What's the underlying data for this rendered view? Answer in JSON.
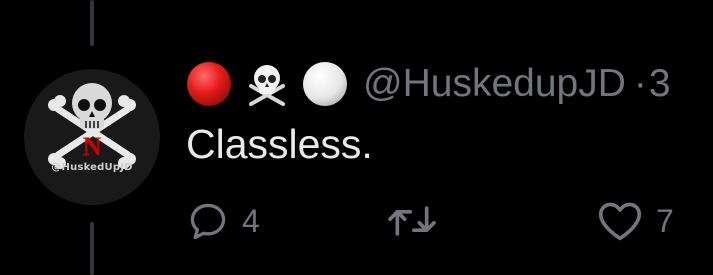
{
  "tweet": {
    "avatar_handle": "@HuskedUpJD",
    "author_emojis": [
      "red-circle",
      "skull-and-crossbones",
      "white-circle"
    ],
    "handle": "@HuskedupJD",
    "separator": "·",
    "time": "3",
    "text": "Classless.",
    "actions": {
      "reply_count": "4",
      "retweet_count": "",
      "like_count": "7"
    }
  },
  "colors": {
    "background": "#000000",
    "primary_text": "#e7e9ea",
    "secondary_text": "#71767b",
    "thread_line": "#333639",
    "husker_red": "#d00000"
  }
}
